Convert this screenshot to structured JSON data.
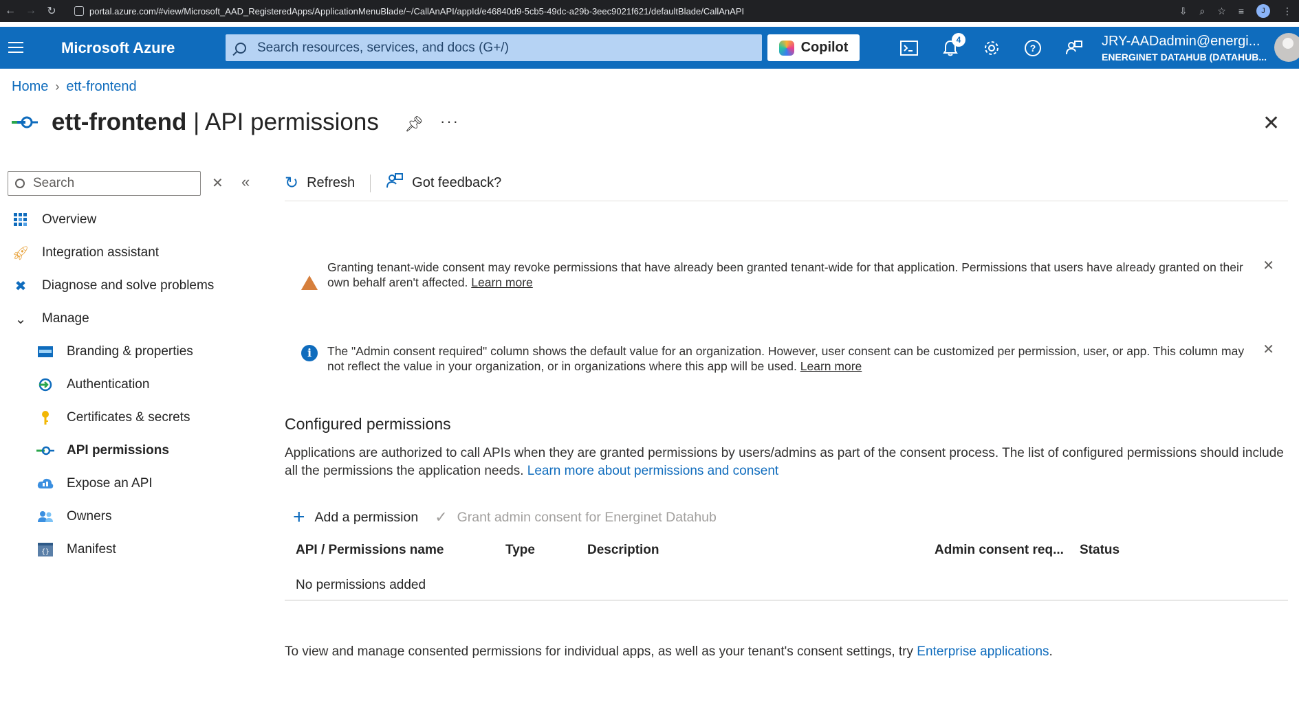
{
  "browser": {
    "url": "portal.azure.com/#view/Microsoft_AAD_RegisteredApps/ApplicationMenuBlade/~/CallAnAPI/appId/e46840d9-5cb5-49dc-a29b-3eec9021f621/defaultBlade/CallAnAPI",
    "profile_initial": "J"
  },
  "topbar": {
    "brand": "Microsoft Azure",
    "search_placeholder": "Search resources, services, and docs (G+/)",
    "copilot_label": "Copilot",
    "notification_count": "4",
    "account_name": "JRY-AADadmin@energi...",
    "account_tenant": "ENERGINET DATAHUB (DATAHUB..."
  },
  "breadcrumb": {
    "home": "Home",
    "current": "ett-frontend"
  },
  "title": {
    "app_name": "ett-frontend",
    "separator": " | ",
    "page": "API permissions"
  },
  "sidebar": {
    "search_placeholder": "Search",
    "items": [
      {
        "label": "Overview",
        "icon": "grid-icon"
      },
      {
        "label": "Integration assistant",
        "icon": "rocket-icon"
      },
      {
        "label": "Diagnose and solve problems",
        "icon": "wrench-icon"
      },
      {
        "label": "Manage",
        "icon": "chevron-down-icon"
      },
      {
        "label": "Branding & properties",
        "icon": "branding-icon"
      },
      {
        "label": "Authentication",
        "icon": "authentication-icon"
      },
      {
        "label": "Certificates & secrets",
        "icon": "key-icon"
      },
      {
        "label": "API permissions",
        "icon": "api-permissions-icon"
      },
      {
        "label": "Expose an API",
        "icon": "cloud-icon"
      },
      {
        "label": "Owners",
        "icon": "people-icon"
      },
      {
        "label": "Manifest",
        "icon": "manifest-icon"
      }
    ]
  },
  "toolbar": {
    "refresh_label": "Refresh",
    "feedback_label": "Got feedback?"
  },
  "banners": {
    "warning_text": "Granting tenant-wide consent may revoke permissions that have already been granted tenant-wide for that application. Permissions that users have already granted on their own behalf aren't affected. ",
    "warning_link": "Learn more",
    "info_text": "The \"Admin consent required\" column shows the default value for an organization. However, user consent can be customized per permission, user, or app. This column may not reflect the value in your organization, or in organizations where this app will be used. ",
    "info_link": "Learn more"
  },
  "configured": {
    "title": "Configured permissions",
    "description": "Applications are authorized to call APIs when they are granted permissions by users/admins as part of the consent process. The list of configured permissions should include all the permissions the application needs. ",
    "description_link": "Learn more about permissions and consent",
    "add_label": "Add a permission",
    "grant_label": "Grant admin consent for Energinet Datahub",
    "columns": [
      "API / Permissions name",
      "Type",
      "Description",
      "Admin consent req...",
      "Status"
    ],
    "empty_text": "No permissions added"
  },
  "footer": {
    "text": "To view and manage consented permissions for individual apps, as well as your tenant's consent settings, try ",
    "link": "Enterprise applications",
    "suffix": "."
  },
  "colors": {
    "azure_blue": "#0f6cbd",
    "warning": "#d67f3c",
    "search_bg": "#b6d3f4"
  }
}
